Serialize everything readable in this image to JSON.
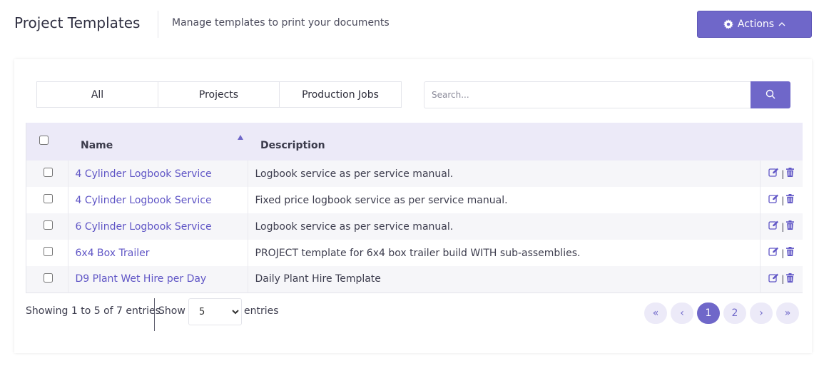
{
  "header": {
    "title": "Project Templates",
    "subtitle": "Manage templates to print your documents",
    "actions_label": "Actions",
    "actions_icon": "gear-icon",
    "actions_caret_icon": "chevron-up-icon"
  },
  "filters": {
    "tabs": [
      {
        "label": "All"
      },
      {
        "label": "Projects"
      },
      {
        "label": "Production Jobs"
      }
    ]
  },
  "search": {
    "placeholder": "Search...",
    "value": "",
    "button_icon": "search-icon"
  },
  "table": {
    "columns": {
      "name": "Name",
      "description": "Description"
    },
    "sort": {
      "column": "Name",
      "direction": "ascending"
    },
    "rows": [
      {
        "name": "4 Cylinder Logbook Service",
        "description": "Logbook service as per service manual."
      },
      {
        "name": "4 Cylinder Logbook Service",
        "description": "Fixed price logbook service as per service manual."
      },
      {
        "name": "6 Cylinder Logbook Service",
        "description": "Logbook service as per service manual."
      },
      {
        "name": "6x4 Box Trailer",
        "description": "PROJECT template for 6x4 box trailer build WITH sub-assemblies."
      },
      {
        "name": "D9 Plant Wet Hire per Day",
        "description": "Daily Plant Hire Template"
      }
    ],
    "row_action_separator": "|",
    "row_action_icons": [
      "edit-icon",
      "trash-icon"
    ]
  },
  "footer": {
    "info": "Showing 1 to 5 of 7 entries",
    "show_label": "Show",
    "page_size": "5",
    "page_size_options": [
      "5"
    ],
    "entries_label": "entries"
  },
  "pagination": {
    "first": "«",
    "prev": "‹",
    "pages": [
      "1",
      "2"
    ],
    "current": "1",
    "next": "›",
    "last": "»"
  },
  "colors": {
    "accent": "#6f67c9",
    "link": "#6056c6",
    "header_bg": "#eceaf8"
  }
}
